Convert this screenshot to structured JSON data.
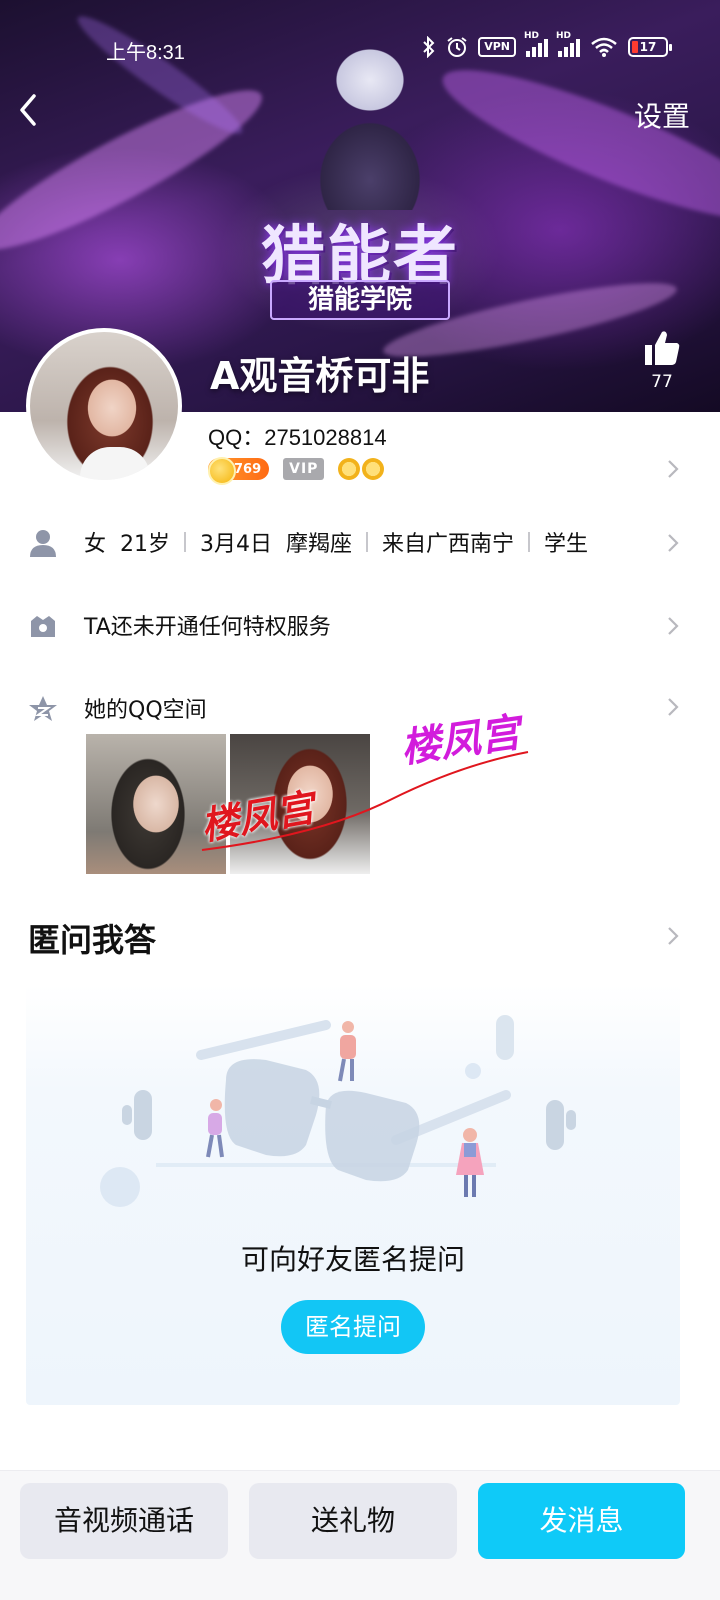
{
  "status_bar": {
    "time": "上午8:31",
    "vpn_label": "VPN",
    "signal1_label": "HD",
    "signal2_label": "HD",
    "battery_level": "17",
    "icons": [
      "bluetooth-icon",
      "alarm-icon",
      "vpn-icon",
      "signal-icon",
      "signal-icon",
      "wifi-icon",
      "battery-icon"
    ]
  },
  "header": {
    "back_icon": "chevron-left-icon",
    "settings_label": "设置",
    "banner_art_title": "猎能者",
    "banner_art_subtitle": "猎能学院",
    "nickname": "A观音桥可非",
    "like_icon": "thumbs-up-icon",
    "like_count": "77"
  },
  "profile": {
    "qq_line": "QQ：2751028814",
    "coin_level": "769",
    "vip_label": "VIP",
    "info": {
      "gender": "女",
      "age": "21岁",
      "birthday": "3月4日",
      "zodiac": "摩羯座",
      "location": "来自广西南宁",
      "occupation": "学生"
    }
  },
  "rows": {
    "privilege_label": "TA还未开通任何特权服务",
    "qzone_label": "她的QQ空间"
  },
  "watermarks": {
    "text1": "楼凤宫",
    "text2": "楼凤宫"
  },
  "anon_qa": {
    "title": "匿问我答",
    "empty_text": "可向好友匿名提问",
    "button_label": "匿名提问"
  },
  "bottom_bar": {
    "call_label": "音视频通话",
    "gift_label": "送礼物",
    "message_label": "发消息"
  },
  "colors": {
    "accent": "#0fcaf8",
    "ask_button": "#12c6f5",
    "secondary_button_bg": "#e8e9f0",
    "watermark_magenta": "#d21cdc",
    "watermark_red": "#e0161e"
  }
}
